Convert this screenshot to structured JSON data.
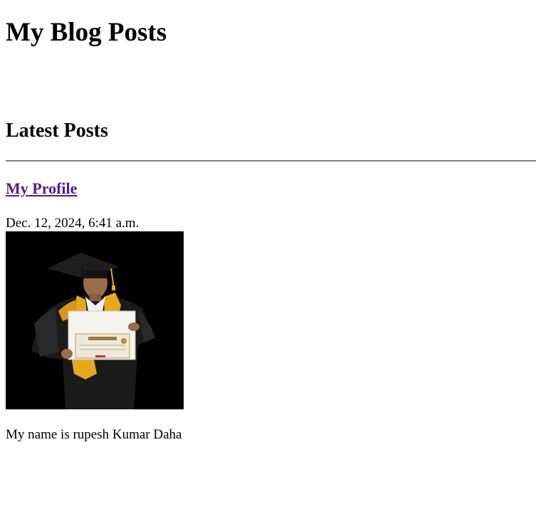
{
  "header": {
    "title": "My Blog Posts"
  },
  "section": {
    "title": "Latest Posts"
  },
  "posts": [
    {
      "title": "My Profile",
      "date": "Dec. 12, 2024, 6:41 a.m.",
      "image": {
        "icon": "graduate-portrait-photo"
      },
      "body": "My name is rupesh Kumar Daha"
    }
  ],
  "colors": {
    "visited_link": "#551a8b",
    "text": "#000000",
    "background": "#ffffff",
    "divider": "#6b6b6b"
  }
}
